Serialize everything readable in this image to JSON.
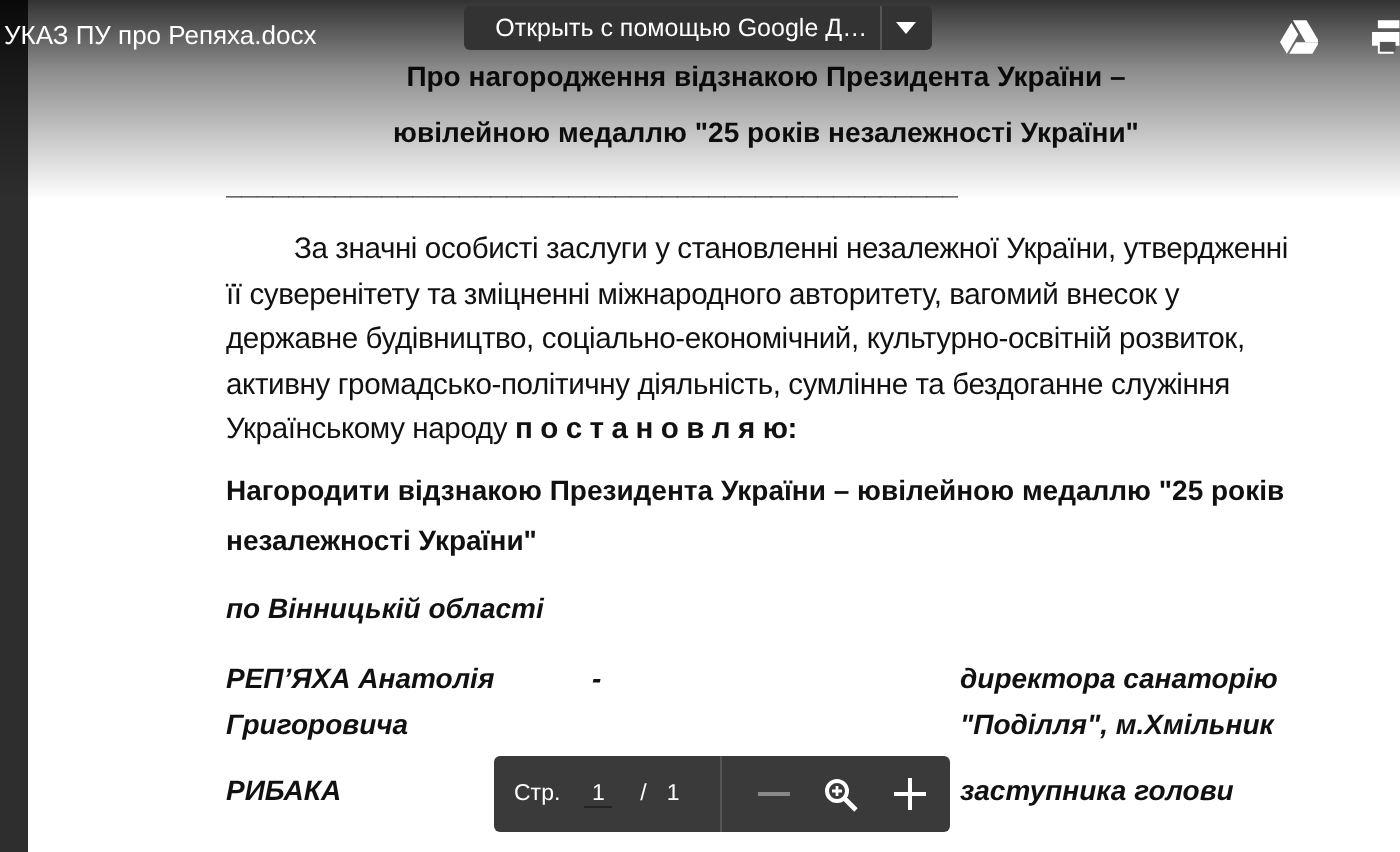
{
  "viewer": {
    "file_name": "УКАЗ ПУ про Репяха.docx",
    "open_with_button": {
      "label": "Открыть с помощью Google Д…"
    }
  },
  "document": {
    "title_lines": [
      "Про нагородження відзнакою Президента України –",
      "ювілейною медаллю \"25 років незалежності України\""
    ],
    "rule": "_______________________________________________",
    "preamble": "За значні особисті заслуги у становленні незалежної України, утвердженні її суверенітету та зміцненні міжнародного авторитету, вагомий внесок у державне будівництво, соціально-економічний, культурно-освітній розвиток, активну громадсько-політичну діяльність, сумлінне та бездоганне служіння Українському народу **п о с т а н о в л я ю:**",
    "decree": "Нагородити відзнакою Президента України – ювілейною медаллю \"25 років незалежності України\"",
    "region": "по Вінницькій області",
    "awardees": [
      {
        "name": "РЕП’ЯХА Анатолія Григоровича",
        "dash": "-",
        "position": "директора санаторію \"Поділля\", м.Хмільник"
      },
      {
        "name": "РИБАКА",
        "position": "заступника голови"
      }
    ]
  },
  "page_toolbar": {
    "label": "Стр.",
    "page": "1",
    "separator": "/",
    "total": "1"
  }
}
